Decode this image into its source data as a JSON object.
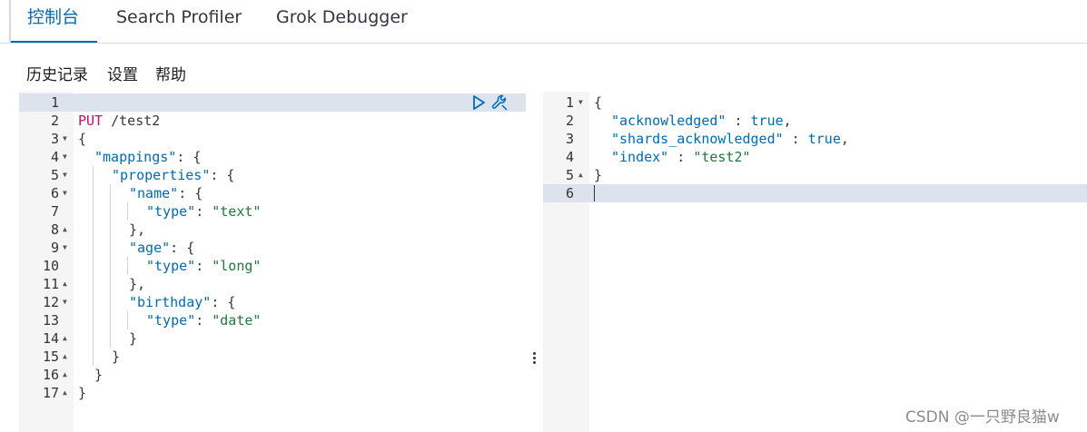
{
  "tabs": [
    {
      "label": "控制台",
      "active": true
    },
    {
      "label": "Search Profiler",
      "active": false
    },
    {
      "label": "Grok Debugger",
      "active": false
    }
  ],
  "menu": {
    "history": "历史记录",
    "settings": "设置",
    "help": "帮助"
  },
  "request_editor": {
    "line_numbers": [
      "1",
      "2",
      "3",
      "4",
      "5",
      "6",
      "7",
      "8",
      "9",
      "10",
      "11",
      "12",
      "13",
      "14",
      "15",
      "16",
      "17"
    ],
    "method": "PUT",
    "url": "/test2",
    "lines": {
      "l3": "{",
      "l4_key": "\"mappings\"",
      "l4_rest": ": {",
      "l5_key": "\"properties\"",
      "l5_rest": ": {",
      "l6_key": "\"name\"",
      "l6_rest": ": {",
      "l7_key": "\"type\"",
      "l7_sep": ": ",
      "l7_val": "\"text\"",
      "l8": "},",
      "l9_key": "\"age\"",
      "l9_rest": ": {",
      "l10_key": "\"type\"",
      "l10_sep": ": ",
      "l10_val": "\"long\"",
      "l11": "},",
      "l12_key": "\"birthday\"",
      "l12_rest": ": {",
      "l13_key": "\"type\"",
      "l13_sep": ": ",
      "l13_val": "\"date\"",
      "l14": "}",
      "l15": "}",
      "l16": "}",
      "l17": "}"
    },
    "run_icon": "play-icon",
    "wrench_icon": "wrench-icon"
  },
  "response_editor": {
    "line_numbers": [
      "1",
      "2",
      "3",
      "4",
      "5",
      "6"
    ],
    "lines": {
      "r1": "{",
      "r2_key": "\"acknowledged\"",
      "r2_sep": " : ",
      "r2_val": "true",
      "r2_end": ",",
      "r3_key": "\"shards_acknowledged\"",
      "r3_sep": " : ",
      "r3_val": "true",
      "r3_end": ",",
      "r4_key": "\"index\"",
      "r4_sep": " : ",
      "r4_val": "\"test2\"",
      "r5": "}"
    }
  },
  "watermark": "CSDN @一只野良猫w",
  "colors": {
    "accent": "#006bb4",
    "method": "#c80a68",
    "string": "#1e7a36",
    "active_line": "#dde3ed"
  }
}
